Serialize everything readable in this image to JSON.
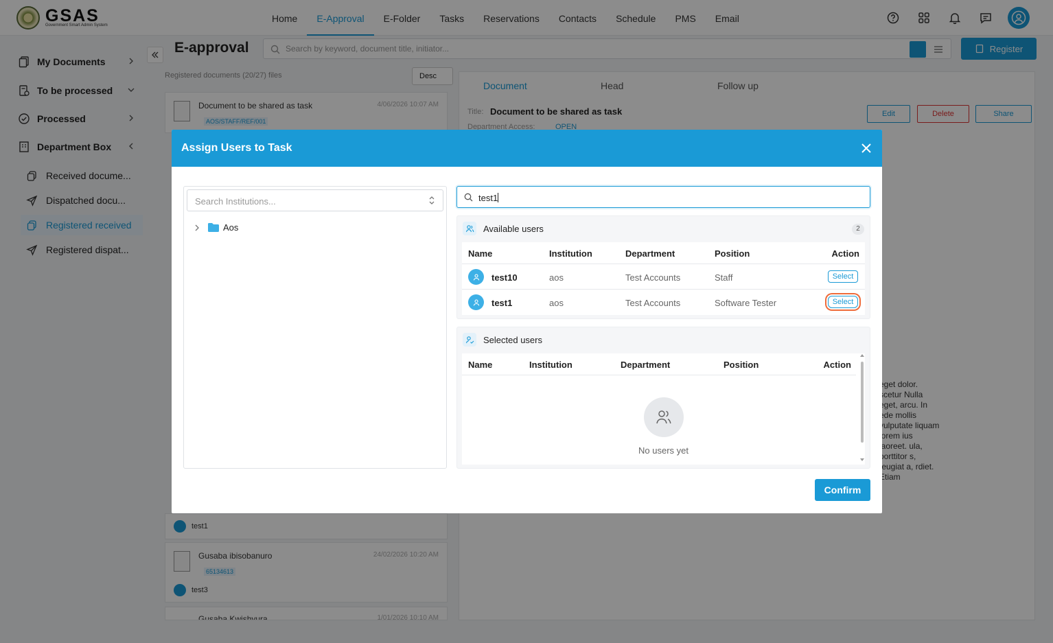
{
  "app": {
    "logo_text": "GSAS",
    "logo_subtitle": "Government Smart Admin System"
  },
  "nav": {
    "items": [
      "Home",
      "E-Approval",
      "E-Folder",
      "Tasks",
      "Reservations",
      "Contacts",
      "Schedule",
      "PMS",
      "Email"
    ],
    "active": "E-Approval"
  },
  "sidebar": {
    "items": [
      {
        "label": "My Documents",
        "icon": "documents-icon"
      },
      {
        "label": "To be processed",
        "icon": "pending-icon"
      },
      {
        "label": "Processed",
        "icon": "check-circle-icon"
      },
      {
        "label": "Department Box",
        "icon": "building-icon"
      }
    ],
    "sub_items": [
      {
        "label": "Received docume...",
        "icon": "copy-icon"
      },
      {
        "label": "Dispatched docu...",
        "icon": "send-icon"
      },
      {
        "label": "Registered received",
        "icon": "copy-icon",
        "active": true
      },
      {
        "label": "Registered dispat...",
        "icon": "send-icon"
      }
    ]
  },
  "page": {
    "title": "E-approval",
    "search_placeholder": "Search by keyword, document title, initiator...",
    "register_label": "Register",
    "registered_count": "Registered documents (20/27) files",
    "sort_label": "Desc"
  },
  "documents": [
    {
      "title": "Document to be shared as task",
      "date": "4/06/2026 10:07 AM",
      "code": "AOS/STAFF/REF/001"
    },
    {
      "user": "test1"
    },
    {
      "title": "Gusaba ibisobanuro",
      "date": "24/02/2026 10:20 AM",
      "code": "65134613",
      "user": "test3"
    },
    {
      "title": "Gusaba Kwishyura",
      "date": "1/01/2026 10:10 AM"
    }
  ],
  "detail": {
    "tabs": [
      "Document",
      "Head",
      "Follow up"
    ],
    "title_label": "Title:",
    "title": "Document to be shared as task",
    "department_access": "Department Access:",
    "status": "OPEN",
    "edit_label": "Edit",
    "delete_label": "Delete",
    "share_label": "Share",
    "body_text": "eget dolor. scetur Nulla eget, arcu. In ede mollis vulputate liquam lorem ius laoreet. ula, porttitor s, feugiat a, rdiet. Etiam"
  },
  "modal": {
    "title": "Assign Users to Task",
    "institution_placeholder": "Search Institutions...",
    "tree": [
      {
        "label": "Aos",
        "icon": "folder-icon"
      }
    ],
    "user_search_value": "test1",
    "available": {
      "title": "Available users",
      "count": "2",
      "headers": [
        "Name",
        "Institution",
        "Department",
        "Position",
        "Action"
      ],
      "rows": [
        {
          "name": "test10",
          "institution": "aos",
          "department": "Test Accounts",
          "position": "Staff",
          "action": "Select"
        },
        {
          "name": "test1",
          "institution": "aos",
          "department": "Test Accounts",
          "position": "Software Tester",
          "action": "Select",
          "focused": true
        }
      ]
    },
    "selected": {
      "title": "Selected users",
      "headers": [
        "Name",
        "Institution",
        "Department",
        "Position",
        "Action"
      ],
      "empty_text": "No users yet"
    },
    "confirm_label": "Confirm"
  },
  "colors": {
    "accent": "#1a9ad6",
    "focus_ring": "#ef6b3a",
    "overlay": "rgba(0,0,0,0.45)"
  }
}
